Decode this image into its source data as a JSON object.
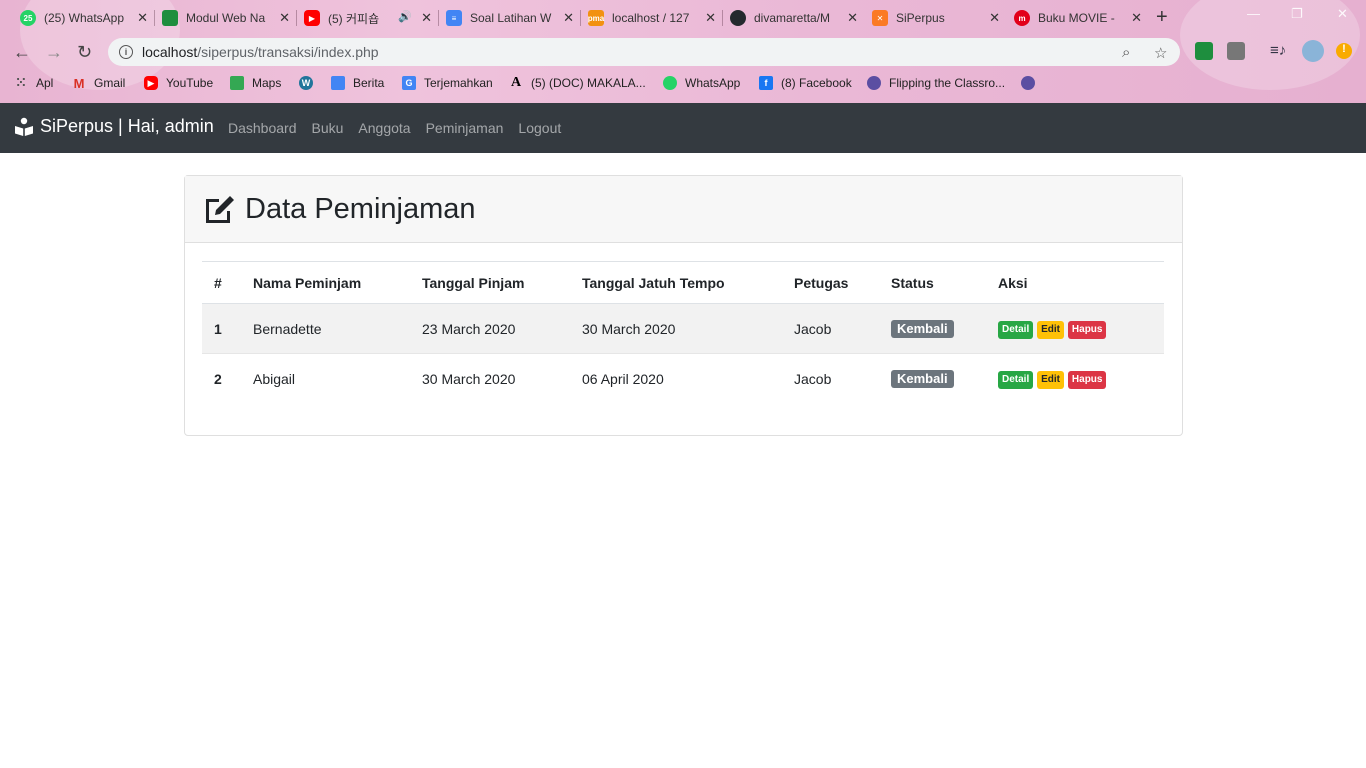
{
  "browser": {
    "tabs": [
      {
        "title": "(25) WhatsApp",
        "icon": "whatsapp-icon",
        "color": "#25d366",
        "badge": "25"
      },
      {
        "title": "Modul Web Na",
        "icon": "classroom-icon",
        "color": "#1e8e3e"
      },
      {
        "title": "(5) 커피숍",
        "icon": "youtube-icon",
        "color": "#ff0000"
      },
      {
        "title": "Soal Latihan W",
        "icon": "docs-icon",
        "color": "#4285f4"
      },
      {
        "title": "localhost / 127",
        "icon": "phpmyadmin-icon",
        "color": "#f29111"
      },
      {
        "title": "divamaretta/M",
        "icon": "github-icon",
        "color": "#24292e"
      },
      {
        "title": "SiPerpus",
        "icon": "xampp-icon",
        "color": "#fb7a24"
      },
      {
        "title": "Buku MOVIE -",
        "icon": "moodle-icon",
        "color": "#e2001a"
      }
    ],
    "url_host": "localhost",
    "url_path": "/siperpus/transaksi/index.php",
    "bookmarks": [
      {
        "label": "Apl",
        "icon": "apps-grid-icon"
      },
      {
        "label": "Gmail",
        "icon": "gmail-icon"
      },
      {
        "label": "YouTube",
        "icon": "youtube-icon"
      },
      {
        "label": "Maps",
        "icon": "maps-icon"
      },
      {
        "label": "",
        "icon": "wordpress-icon"
      },
      {
        "label": "Berita",
        "icon": "news-icon"
      },
      {
        "label": "Terjemahkan",
        "icon": "translate-icon"
      },
      {
        "label": "(5) (DOC) MAKALA...",
        "icon": "academia-icon"
      },
      {
        "label": "WhatsApp",
        "icon": "whatsapp-icon"
      },
      {
        "label": "(8) Facebook",
        "icon": "facebook-icon"
      },
      {
        "label": "Flipping the Classro...",
        "icon": "globe-icon"
      },
      {
        "label": "",
        "icon": "globe-icon"
      }
    ]
  },
  "app": {
    "brand": "SiPerpus | Hai, admin",
    "nav": [
      "Dashboard",
      "Buku",
      "Anggota",
      "Peminjaman",
      "Logout"
    ],
    "page_title": "Data Peminjaman",
    "table": {
      "headers": [
        "#",
        "Nama Peminjam",
        "Tanggal Pinjam",
        "Tanggal Jatuh Tempo",
        "Petugas",
        "Status",
        "Aksi"
      ],
      "rows": [
        {
          "no": "1",
          "nama": "Bernadette",
          "pinjam": "23 March 2020",
          "tempo": "30 March 2020",
          "petugas": "Jacob",
          "status": "Kembali"
        },
        {
          "no": "2",
          "nama": "Abigail",
          "pinjam": "30 March 2020",
          "tempo": "06 April 2020",
          "petugas": "Jacob",
          "status": "Kembali"
        }
      ],
      "actions": {
        "detail": "Detail",
        "edit": "Edit",
        "hapus": "Hapus"
      }
    }
  },
  "colors": {
    "navbar": "#343a40",
    "status_badge": "#6c757d",
    "detail": "#28a745",
    "edit": "#ffc107",
    "hapus": "#dc3545"
  }
}
